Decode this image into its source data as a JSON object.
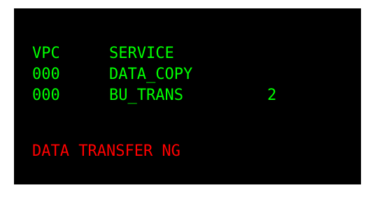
{
  "header": {
    "col_vpc": "VPC",
    "col_service": "SERVICE"
  },
  "rows": [
    {
      "vpc": "000",
      "service": "DATA_COPY",
      "value": ""
    },
    {
      "vpc": "000",
      "service": "BU_TRANS",
      "value": "2"
    }
  ],
  "status": {
    "message": "DATA TRANSFER NG"
  },
  "colors": {
    "background": "#000000",
    "normal_text": "#00ff00",
    "error_text": "#ff0000"
  }
}
